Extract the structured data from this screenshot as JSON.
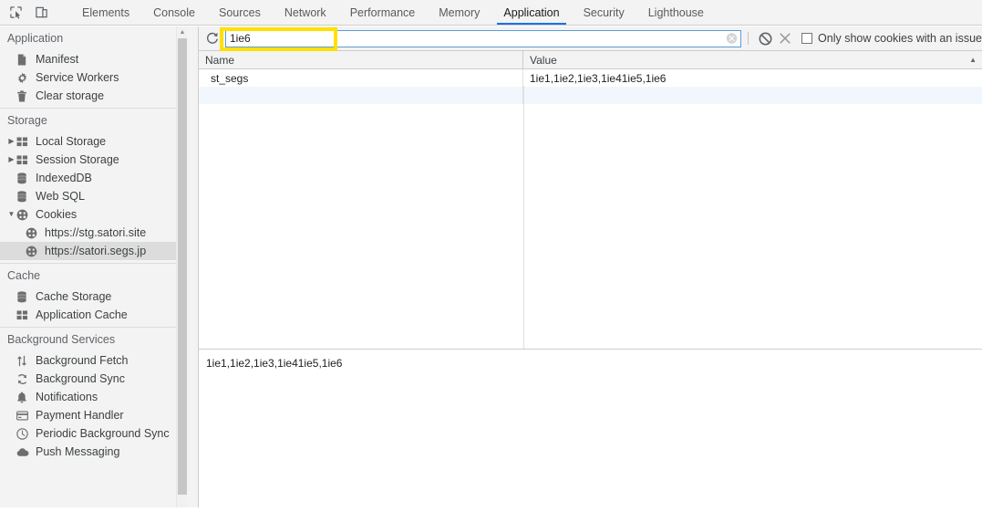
{
  "toolbar": {
    "inspect_icon": "inspect-element-icon",
    "device_icon": "device-toolbar-icon",
    "tabs": [
      {
        "label": "Elements",
        "active": false
      },
      {
        "label": "Console",
        "active": false
      },
      {
        "label": "Sources",
        "active": false
      },
      {
        "label": "Network",
        "active": false
      },
      {
        "label": "Performance",
        "active": false
      },
      {
        "label": "Memory",
        "active": false
      },
      {
        "label": "Application",
        "active": true
      },
      {
        "label": "Security",
        "active": false
      },
      {
        "label": "Lighthouse",
        "active": false
      }
    ]
  },
  "sidebar": {
    "sections": [
      {
        "title": "Application",
        "items": [
          {
            "label": "Manifest",
            "icon": "manifest-document-icon",
            "twisty": "",
            "selected": false
          },
          {
            "label": "Service Workers",
            "icon": "gear-icon",
            "twisty": "",
            "selected": false
          },
          {
            "label": "Clear storage",
            "icon": "trash-icon",
            "twisty": "",
            "selected": false
          }
        ]
      },
      {
        "title": "Storage",
        "items": [
          {
            "label": "Local Storage",
            "icon": "table-icon",
            "twisty": "collapsed",
            "selected": false
          },
          {
            "label": "Session Storage",
            "icon": "table-icon",
            "twisty": "collapsed",
            "selected": false
          },
          {
            "label": "IndexedDB",
            "icon": "database-icon",
            "twisty": "",
            "selected": false
          },
          {
            "label": "Web SQL",
            "icon": "database-icon",
            "twisty": "",
            "selected": false
          },
          {
            "label": "Cookies",
            "icon": "cookie-icon",
            "twisty": "expanded",
            "selected": false
          },
          {
            "label": "https://stg.satori.site",
            "icon": "cookie-icon",
            "twisty": "",
            "selected": false,
            "indent": true
          },
          {
            "label": "https://satori.segs.jp",
            "icon": "cookie-icon",
            "twisty": "",
            "selected": true,
            "indent": true
          }
        ]
      },
      {
        "title": "Cache",
        "items": [
          {
            "label": "Cache Storage",
            "icon": "database-icon",
            "twisty": "",
            "selected": false
          },
          {
            "label": "Application Cache",
            "icon": "table-icon",
            "twisty": "",
            "selected": false
          }
        ]
      },
      {
        "title": "Background Services",
        "items": [
          {
            "label": "Background Fetch",
            "icon": "arrows-up-down-icon",
            "twisty": "",
            "selected": false
          },
          {
            "label": "Background Sync",
            "icon": "sync-refresh-icon",
            "twisty": "",
            "selected": false
          },
          {
            "label": "Notifications",
            "icon": "bell-icon",
            "twisty": "",
            "selected": false
          },
          {
            "label": "Payment Handler",
            "icon": "credit-card-icon",
            "twisty": "",
            "selected": false
          },
          {
            "label": "Periodic Background Sync",
            "icon": "clock-icon",
            "twisty": "",
            "selected": false
          },
          {
            "label": "Push Messaging",
            "icon": "cloud-icon",
            "twisty": "",
            "selected": false
          }
        ]
      }
    ]
  },
  "cookie_toolbar": {
    "refresh_icon": "refresh-icon",
    "filter_value": "1ie6",
    "filter_placeholder": "Filter",
    "clear_filter_icon": "clear-circle-icon",
    "clear_all_cookies_icon": "block-clear-all-icon",
    "delete_selected_icon": "close-x-icon",
    "only_show_issues_label": "Only show cookies with an issue",
    "only_show_issues_checked": false,
    "highlight_color": "#ffe000"
  },
  "grid": {
    "columns": [
      "Name",
      "Value"
    ],
    "sort_indicator": "▲",
    "rows": [
      {
        "name": "st_segs",
        "value": "1ie1,1ie2,1ie3,1ie41ie5,1ie6"
      }
    ]
  },
  "preview": {
    "text": "1ie1,1ie2,1ie3,1ie41ie5,1ie6"
  }
}
